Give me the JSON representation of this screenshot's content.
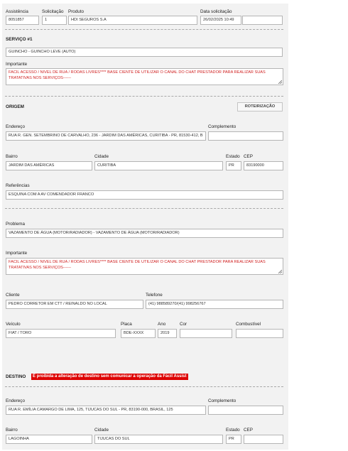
{
  "header": {
    "assistencia_label": "Assistência",
    "assistencia_value": "8051857",
    "solicitacao_label": "Solicitação",
    "solicitacao_value": "1",
    "produto_label": "Produto",
    "produto_value": "HDI SEGUROS S.A",
    "data_label": "Data solicitação",
    "data_value": "26/02/2025 10:49",
    "extra_value": ""
  },
  "servico": {
    "title": "SERVIÇO #1",
    "service_value": "GUINCHO - GUINCHO LEVE (AUTO)",
    "importante_label": "Importante",
    "importante_text": "FACIL ACESSO / NIVEL DE RUA / RODAS LIVRES**** BASE CIENTE DE UTILIZAR O CANAL DO CHAT PRESTADOR PARA REALIZAR SUAS TRATATIVAS NOS SERVIÇOS------"
  },
  "origem": {
    "title": "ORIGEM",
    "roteirizacao_button": "ROTEIRIZAÇÃO",
    "endereco_label": "Endereço",
    "endereco_value": "RUA R. GEN. SETEMBRINO DE CARVALHO, 236 - JARDIM DAS AMÉRICAS, CURITIBA - PR, 81530-412, B",
    "complemento_label": "Complemento",
    "complemento_value": "",
    "bairro_label": "Bairro",
    "bairro_value": "JARDIM DAS AMÉRICAS",
    "cidade_label": "Cidade",
    "cidade_value": "CURITIBA",
    "estado_label": "Estado",
    "estado_value": "PR",
    "cep_label": "CEP",
    "cep_value": "83190000",
    "referencias_label": "Referências",
    "referencias_value": "ESQUINA COM A AV COMENDADOR FRANCO",
    "problema_label": "Problema",
    "problema_value": "VAZAMENTO DE ÁGUA (MOTOR/RADIADOR) - VAZAMENTO DE ÁGUA (MOTOR/RADIADOR)",
    "importante_label": "Importante",
    "importante_text": "FACIL ACESSO / NIVEL DE RUA / RODAS LIVRES**** BASE CIENTE DE UTILIZAR O CANAL DO CHAT PRESTADOR PARA REALIZAR SUAS TRATATIVAS NOS SERVIÇOS------",
    "cliente_label": "Cliente",
    "cliente_value": "PEDRO CORRETOR EM CTT / REINALDO NO LOCAL",
    "telefone_label": "Telefone",
    "telefone_value": "(41) 988589270/(41) 998256767",
    "veiculo_label": "Veículo",
    "veiculo_value": "FIAT / TORO",
    "placa_label": "Placa",
    "placa_value": "BDE-XXXX",
    "ano_label": "Ano",
    "ano_value": "2019",
    "cor_label": "Cor",
    "cor_value": "",
    "combustivel_label": "Combustível",
    "combustivel_value": ""
  },
  "destino": {
    "title": "DESTINO",
    "warning": "É proibida a alteração de destino sem comunicar a operação da Fácil Assist",
    "endereco_label": "Endereço",
    "endereco_value": "RUA R. EMÍLIA CAMARGO DE LIMA, 125, TIJUCAS DO SUL - PR, 83190-000, BRASIL, 125",
    "complemento_label": "Complemento",
    "complemento_value": "",
    "bairro_label": "Bairro",
    "bairro_value": "LAGOINHA",
    "cidade_label": "Cidade",
    "cidade_value": "TIJUCAS DO SUL",
    "estado_label": "Estado",
    "estado_value": "PR",
    "cep_label": "CEP",
    "cep_value": ""
  },
  "colors": {
    "panel": "#f2f2f2",
    "warning": "#dd0000",
    "important_text": "#d02020"
  }
}
